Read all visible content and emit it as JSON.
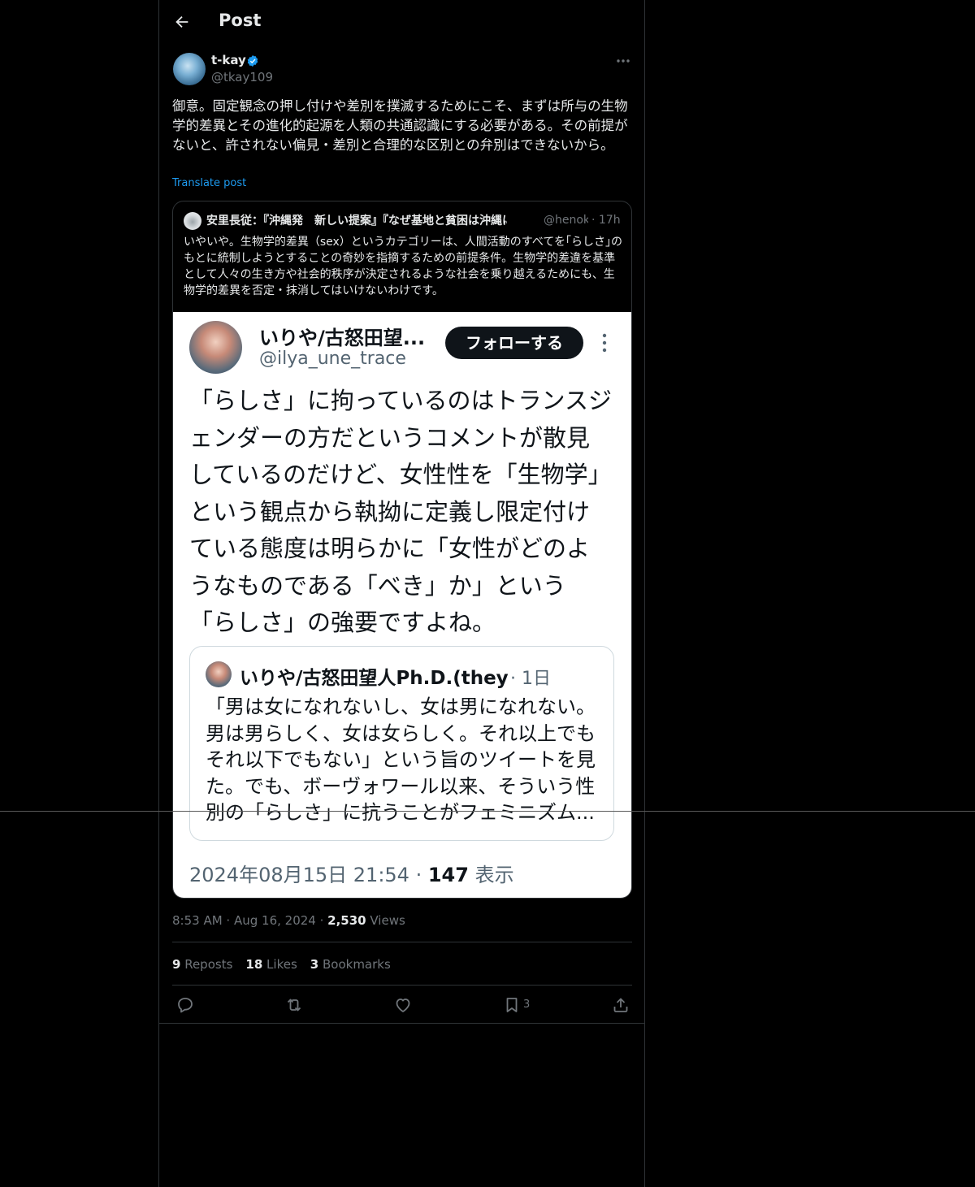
{
  "header": {
    "title": "Post"
  },
  "author": {
    "name": "t-kay",
    "handle": "@tkay109"
  },
  "post": {
    "text": "御意。固定観念の押し付けや差別を撲滅するためにこそ、まずは所与の生物学的差異とその進化的起源を人類の共通認識にする必要がある。その前提がないと、許されない偏見・差別と合理的な区別との弁別はできないから。",
    "translate_label": "Translate post"
  },
  "quote": {
    "name": "安里長従：『沖縄発　新しい提案』『なぜ基地と貧困は沖縄に",
    "handle": "@henok",
    "time": "· 17h",
    "text": "いやいや。生物学的差異（sex）というカテゴリーは、人間活動のすべてを｢らしさ｣のもとに統制しようとすることの奇妙を指摘するための前提条件。生物学的差違を基準として人々の生き方や社会的秩序が決定されるような社会を乗り越えるためにも、生物学的差異を否定・抹消してはいけないわけです。",
    "screenshot": {
      "name": "いりや/古怒田望...",
      "handle": "@ilya_une_trace",
      "follow_label": "フォローする",
      "text": "「らしさ」に拘っているのはトランスジェンダーの方だというコメントが散見しているのだけど、女性性を「生物学」という観点から執拗に定義し限定付けている態度は明らかに「女性がどのようなものである「べき」か」という「らしさ」の強要ですよね。",
      "embedded": {
        "name": "いりや/古怒田望人Ph.D.(they/the...",
        "time": "· 1日",
        "text": "「男は女になれないし、女は男になれない。男は男らしく、女は女らしく。それ以上でもそれ以下でもない」という旨のツイートを見た。でも、ボーヴォワール以来、そういう性別の「らしさ」に抗うことがフェミニズム..."
      },
      "date": "2024年08月15日 21:54 · ",
      "views_count": "147",
      "views_label": " 表示"
    }
  },
  "meta": {
    "time": "8:53 AM",
    "sep1": " · ",
    "date": "Aug 16, 2024",
    "sep2": " · ",
    "views_count": "2,530",
    "views_label": " Views"
  },
  "stats": {
    "reposts_count": "9",
    "reposts_label": " Reposts",
    "likes_count": "18",
    "likes_label": " Likes",
    "bookmarks_count": "3",
    "bookmarks_label": " Bookmarks"
  },
  "actions": {
    "bookmark_count": "3"
  },
  "icons": [
    "back-arrow-icon",
    "verified-badge-icon",
    "more-icon",
    "reply-icon",
    "repost-icon",
    "like-icon",
    "bookmark-icon",
    "share-icon"
  ],
  "colors": {
    "accent": "#1d9bf0",
    "background": "#000000",
    "muted": "#71767b"
  }
}
